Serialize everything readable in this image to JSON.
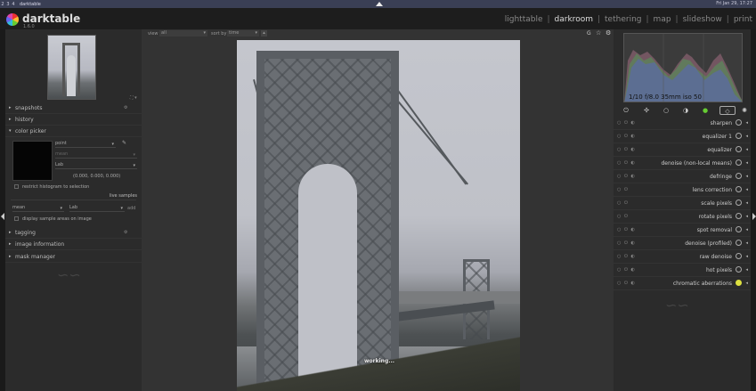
{
  "system": {
    "workspaces": [
      "2",
      "3",
      "4"
    ],
    "app_title": "darktable",
    "clock": "Fri Jan 29, 17:27"
  },
  "header": {
    "brand": "darktable",
    "version": "1.6.0",
    "views": [
      "lighttable",
      "darkroom",
      "tethering",
      "map",
      "slideshow",
      "print"
    ],
    "active_view": "darkroom",
    "separator": "|"
  },
  "left": {
    "modules": [
      {
        "arrow": "▸",
        "label": "snapshots",
        "pin": "⚙"
      },
      {
        "arrow": "▸",
        "label": "history",
        "pin": ""
      },
      {
        "arrow": "▾",
        "label": "color picker",
        "pin": ""
      }
    ],
    "color_picker": {
      "mode": "point",
      "mean_field": "mean",
      "colorspace": "Lab",
      "values": "(0.000, 0.000, 0.000)",
      "restrict_label": "restrict histogram to selection",
      "live_samples": "live samples",
      "stat": "mean",
      "stat_space": "Lab",
      "add": "add",
      "display_label": "display sample areas on image"
    },
    "modules_bottom": [
      {
        "arrow": "▸",
        "label": "tagging",
        "pin": "⚙"
      },
      {
        "arrow": "▸",
        "label": "image information",
        "pin": ""
      },
      {
        "arrow": "▸",
        "label": "mask manager",
        "pin": ""
      }
    ]
  },
  "center": {
    "view_label": "view",
    "view_value": "all",
    "sort_label": "sort by",
    "sort_value": "time",
    "working": "working..."
  },
  "right": {
    "exif": "1/10 f/8.0 35mm iso 50",
    "modules": [
      {
        "name": "sharpen",
        "toggles": "○ ⏻ ◐",
        "active": false
      },
      {
        "name": "equalizer 1",
        "toggles": "○ ⏻ ◐",
        "active": false
      },
      {
        "name": "equalizer",
        "toggles": "○ ⏻ ◐",
        "active": false
      },
      {
        "name": "denoise (non-local means)",
        "toggles": "○ ⏻ ◐",
        "active": false
      },
      {
        "name": "defringe",
        "toggles": "○ ⏻ ◐",
        "active": false
      },
      {
        "name": "lens correction",
        "toggles": "○ ⏻",
        "active": false
      },
      {
        "name": "scale pixels",
        "toggles": "○ ⏻",
        "active": false
      },
      {
        "name": "rotate pixels",
        "toggles": "○ ⏻",
        "active": false
      },
      {
        "name": "spot removal",
        "toggles": "○ ⏻ ◐",
        "active": false
      },
      {
        "name": "denoise (profiled)",
        "toggles": "○ ⏻ ◐",
        "active": false
      },
      {
        "name": "raw denoise",
        "toggles": "○ ⏻ ◐",
        "active": false
      },
      {
        "name": "hot pixels",
        "toggles": "○ ⏻ ◐",
        "active": false
      },
      {
        "name": "chromatic aberrations",
        "toggles": "○ ⏻ ◐",
        "active": true
      }
    ]
  },
  "colors": {
    "accent": "#dde040",
    "panel": "#2b2b2b",
    "center": "#333333"
  }
}
